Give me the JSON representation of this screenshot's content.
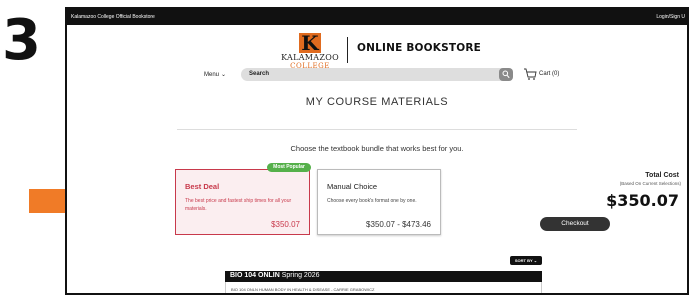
{
  "step_number": "3",
  "topbar": {
    "store_name": "Kalamazoo College Official Bookstore",
    "login": "Login/Sign U"
  },
  "logo": {
    "letter": "K",
    "line1": "KALAMAZOO",
    "line2": "COLLEGE"
  },
  "header": {
    "store_title": "ONLINE BOOKSTORE",
    "menu_label": "Menu",
    "search_placeholder": "Search",
    "cart_label": "Cart (0)"
  },
  "page": {
    "title": "MY COURSE MATERIALS",
    "prompt": "Choose the textbook bundle that works best for you."
  },
  "bundles": {
    "best": {
      "badge": "Most Popular",
      "title": "Best Deal",
      "desc": "The best price and fastest ship times for all your materials.",
      "price": "$350.07"
    },
    "manual": {
      "title": "Manual Choice",
      "desc": "Choose every book's format one by one.",
      "price": "$350.07 - $473.46"
    }
  },
  "total": {
    "label": "Total Cost",
    "sub": "(Based On Current Selections)",
    "amount": "$350.07",
    "checkout_label": "Checkout"
  },
  "list": {
    "sort_label": "SORT BY",
    "course_code": "BIO 104 ONLIN",
    "course_term": "Spring 2026",
    "course_detail": "BIO 104 ONLN HUMAN BODY IN HEALTH & DISEASE - CARRIE GRABOWICZ"
  },
  "colors": {
    "accent_red": "#c8394b",
    "arrow_orange": "#f07b27",
    "badge_green": "#55b04a",
    "kzoo_orange": "#e06b1f"
  }
}
